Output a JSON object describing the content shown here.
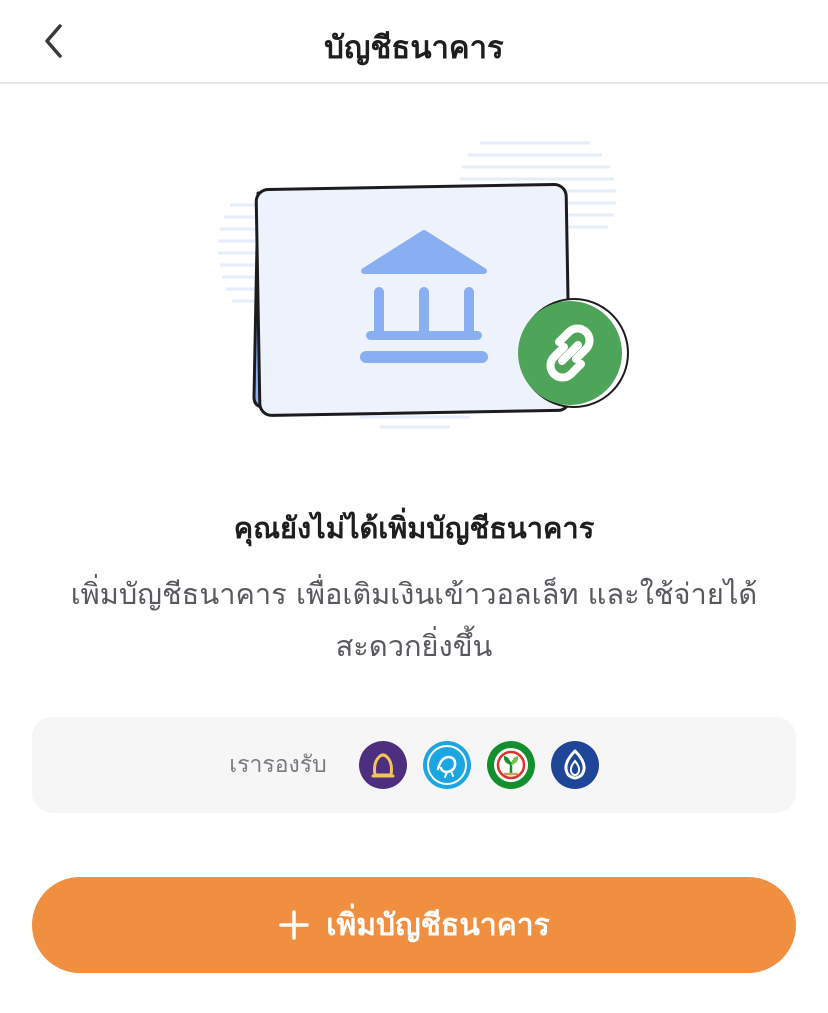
{
  "header": {
    "title": "บัญชีธนาคาร",
    "back_icon": "chevron-left-icon"
  },
  "illustration": {
    "bank_icon": "bank-building-icon",
    "link_icon": "link-chain-icon"
  },
  "empty_state": {
    "title": "คุณยังไม่ได้เพิ่มบัญชีธนาคาร",
    "description": "เพิ่มบัญชีธนาคาร เพื่อเติมเงินเข้าวอลเล็ท และใช้จ่ายได้สะดวกยิ่งขึ้น"
  },
  "supported_banks": {
    "label": "เรารองรับ",
    "banks": [
      {
        "icon": "scb-bank-logo",
        "color": "#4e2e7f"
      },
      {
        "icon": "krungthai-bank-logo",
        "color": "#1ba5e1"
      },
      {
        "icon": "kasikorn-bank-logo",
        "color": "#138f2d"
      },
      {
        "icon": "bangkok-bank-logo",
        "color": "#1e4598"
      }
    ]
  },
  "add_button": {
    "label": "เพิ่มบัญชีธนาคาร",
    "icon": "plus-icon",
    "color": "#ef8f3f"
  }
}
